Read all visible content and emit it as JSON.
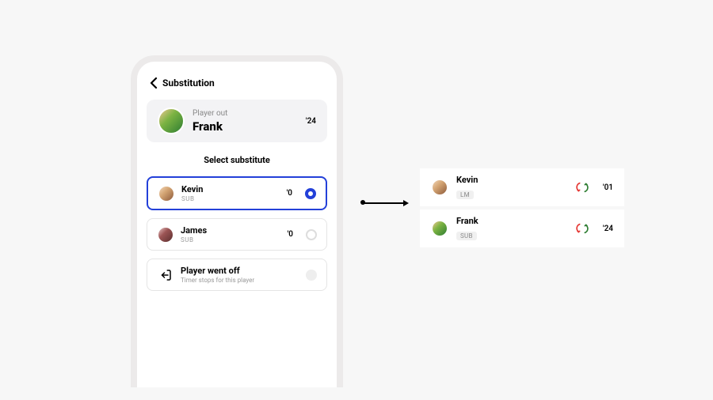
{
  "header": {
    "title": "Substitution"
  },
  "player_out": {
    "label": "Player out",
    "name": "Frank",
    "time": "'24"
  },
  "section_title": "Select substitute",
  "substitutes": [
    {
      "name": "Kevin",
      "role": "SUB",
      "time": "'0",
      "selected": true
    },
    {
      "name": "James",
      "role": "SUB",
      "time": "'0",
      "selected": false
    }
  ],
  "went_off": {
    "title": "Player went off",
    "subtitle": "Timer stops for this player"
  },
  "result": [
    {
      "name": "Kevin",
      "role": "LM",
      "time": "'01"
    },
    {
      "name": "Frank",
      "role": "SUB",
      "time": "'24"
    }
  ]
}
